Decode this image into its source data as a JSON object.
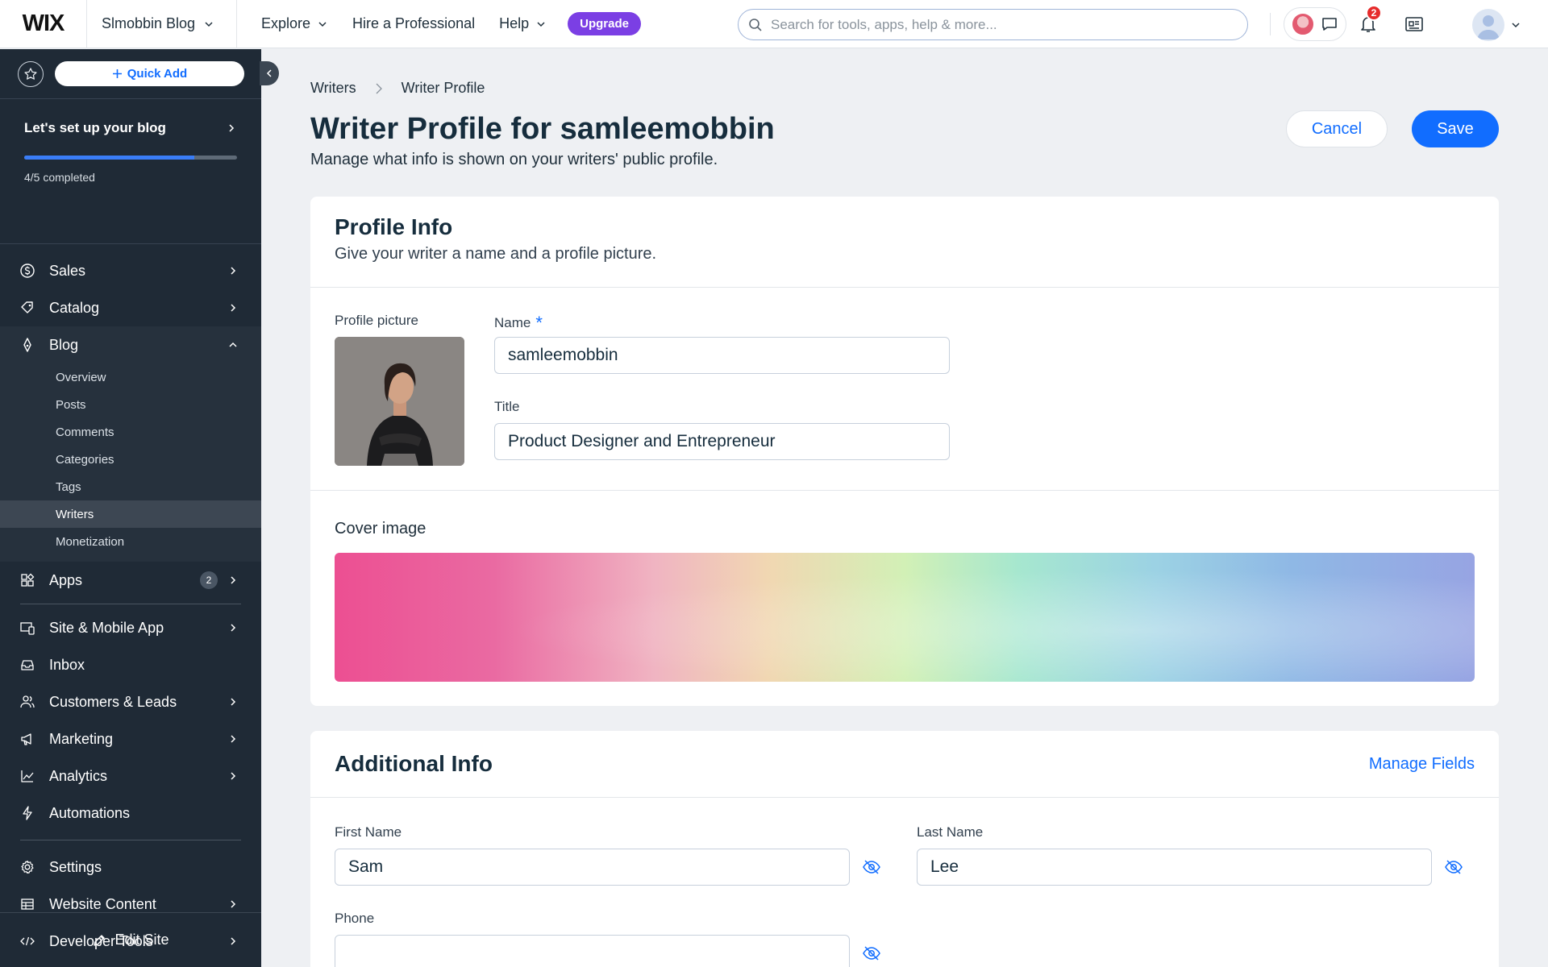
{
  "topbar": {
    "logo": "WIX",
    "site_name": "Slmobbin Blog",
    "nav": [
      "Explore",
      "Hire a Professional",
      "Help"
    ],
    "upgrade": "Upgrade",
    "search_placeholder": "Search for tools, apps, help & more...",
    "notification_count": "2"
  },
  "sidebar": {
    "quick_add": "Quick Add",
    "setup_title": "Let's set up your blog",
    "setup_progress": 0.8,
    "setup_status": "4/5 completed",
    "items_top": [
      {
        "label": "Sales"
      },
      {
        "label": "Catalog"
      },
      {
        "label": "Blog"
      }
    ],
    "blog_sub": [
      "Overview",
      "Posts",
      "Comments",
      "Categories",
      "Tags",
      "Writers",
      "Monetization"
    ],
    "active_sub": "Writers",
    "apps": {
      "label": "Apps",
      "badge": "2"
    },
    "items_mid": [
      "Site & Mobile App",
      "Inbox",
      "Customers & Leads",
      "Marketing",
      "Analytics",
      "Automations"
    ],
    "items_bottom": [
      "Settings",
      "Website Content",
      "Developer Tools"
    ],
    "edit_site": "Edit Site"
  },
  "main": {
    "breadcrumb": {
      "parent": "Writers",
      "current": "Writer Profile"
    },
    "title": "Writer Profile for samleemobbin",
    "subtitle": "Manage what info is shown on your writers' public profile.",
    "cancel": "Cancel",
    "save": "Save",
    "profile_info": {
      "title": "Profile Info",
      "subtitle": "Give your writer a name and a profile picture.",
      "picture_label": "Profile picture",
      "name_label": "Name",
      "required_mark": "*",
      "name_value": "samleemobbin",
      "title_label": "Title",
      "title_value": "Product Designer and Entrepreneur",
      "cover_label": "Cover image"
    },
    "additional_info": {
      "title": "Additional Info",
      "manage_fields": "Manage Fields",
      "first_name_label": "First Name",
      "first_name_value": "Sam",
      "last_name_label": "Last Name",
      "last_name_value": "Lee",
      "phone_label": "Phone",
      "phone_value": ""
    }
  },
  "colors": {
    "accent": "#116dff",
    "sidebar_bg": "#1f2a36",
    "upgrade": "#7b3fe4",
    "badge": "#e62b2b"
  }
}
